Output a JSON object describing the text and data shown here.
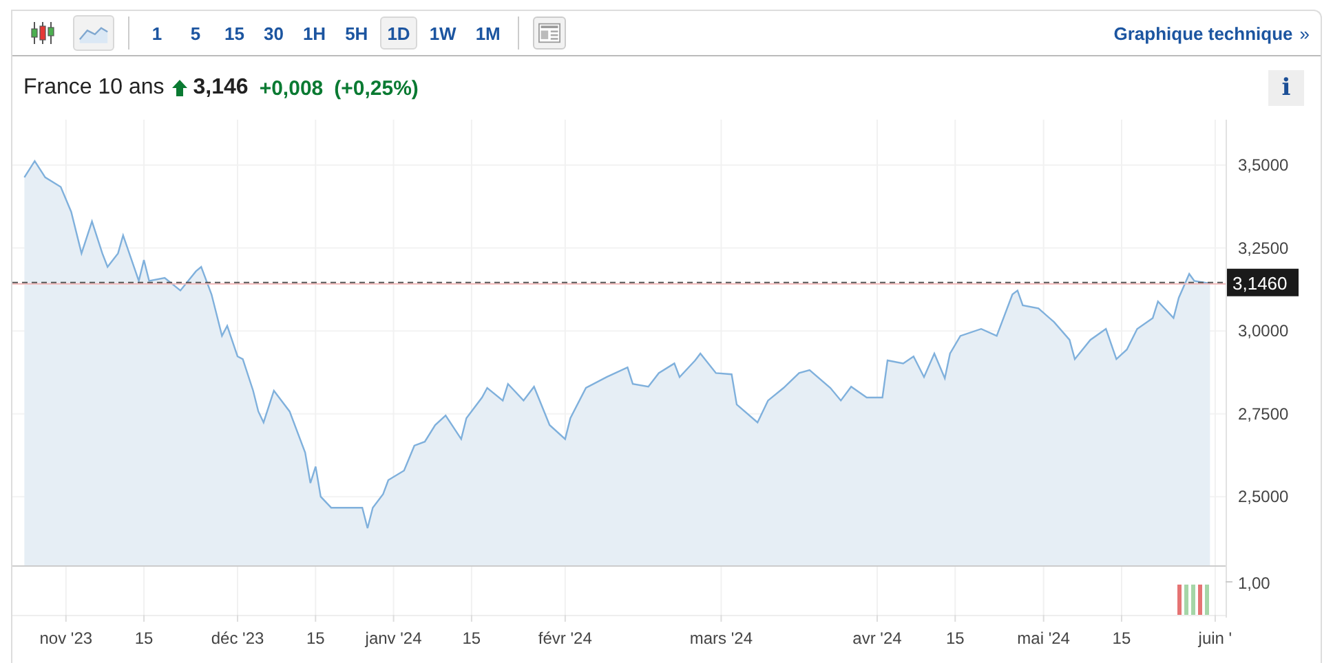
{
  "toolbar": {
    "line_view_selected": true,
    "intervals": [
      {
        "label": "1",
        "selected": false
      },
      {
        "label": "5",
        "selected": false
      },
      {
        "label": "15",
        "selected": false
      },
      {
        "label": "30",
        "selected": false
      },
      {
        "label": "1H",
        "selected": false
      },
      {
        "label": "5H",
        "selected": false
      },
      {
        "label": "1D",
        "selected": true
      },
      {
        "label": "1W",
        "selected": false
      },
      {
        "label": "1M",
        "selected": false
      }
    ],
    "technical_chart_link": {
      "label": "Graphique technique",
      "chevron": "»"
    }
  },
  "quote": {
    "name": "France 10 ans",
    "rising": true,
    "price": "3,146",
    "change": "+0,008",
    "change_percent": "(+0,25%)",
    "info_button": "i"
  },
  "chart": {
    "y_axis_labels": [
      "3,5000",
      "3,2500",
      "3,0000",
      "2,7500",
      "2,5000"
    ],
    "x_axis_labels": [
      "nov '23",
      "15",
      "déc '23",
      "15",
      "janv '24",
      "15",
      "févr '24",
      "mars '24",
      "avr '24",
      "15",
      "mai '24",
      "15",
      "juin '"
    ],
    "price_tag": "3,1460",
    "volume": {
      "tick": "1,00",
      "bars": [
        {
          "color": "#e57373"
        },
        {
          "color": "#a5d6a7"
        },
        {
          "color": "#a5d6a7"
        },
        {
          "color": "#e57373"
        },
        {
          "color": "#a5d6a7"
        }
      ]
    }
  }
}
